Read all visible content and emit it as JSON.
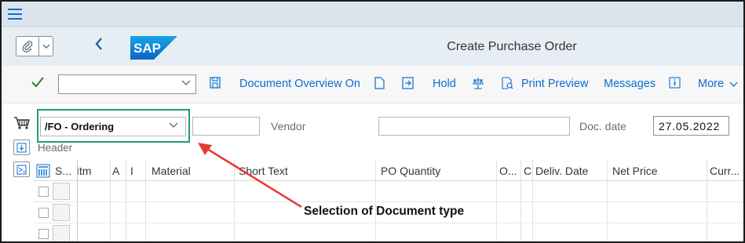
{
  "shell": {
    "title": "Create Purchase Order",
    "logo_text": "SAP"
  },
  "toolbar": {
    "document_overview": "Document Overview On",
    "hold": "Hold",
    "print_preview": "Print Preview",
    "messages": "Messages",
    "more": "More",
    "combo_value": ""
  },
  "document": {
    "doc_type_value": "/FO - Ordering",
    "vendor_label": "Vendor",
    "doc_date_label": "Doc. date",
    "doc_date_value": "27.05.2022",
    "header_label": "Header"
  },
  "table": {
    "columns": [
      "S...",
      "Itm",
      "A",
      "I",
      "Material",
      "Short Text",
      "PO Quantity",
      "O...",
      "C",
      "Deliv. Date",
      "Net Price",
      "Curr..."
    ],
    "rows": 3
  },
  "annotation": {
    "text": "Selection of Document type",
    "color": "#e53935"
  },
  "icons": [
    "menu-icon",
    "paperclip-icon",
    "back-icon",
    "checkmark-icon",
    "save-icon",
    "document-icon",
    "export-icon",
    "balance-icon",
    "print-preview-icon",
    "info-icon",
    "cart-icon",
    "header-expand-icon",
    "item-expand-icon",
    "table-settings-icon"
  ],
  "colors": {
    "accent": "#0a6ed1",
    "highlight_box": "#1f9e6e",
    "sap_logo": "#1a7fd4"
  }
}
